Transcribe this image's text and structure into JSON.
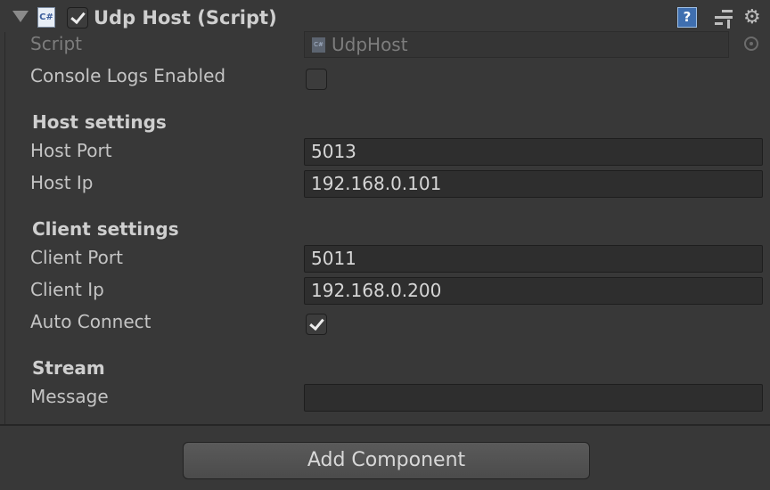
{
  "component": {
    "title": "Udp Host (Script)",
    "enabled": true,
    "icon_text": "C#"
  },
  "fields": {
    "script_label": "Script",
    "script_value": "UdpHost",
    "console_logs_label": "Console Logs Enabled",
    "console_logs_checked": false,
    "host_section": "Host settings",
    "host_port_label": "Host Port",
    "host_port_value": "5013",
    "host_ip_label": "Host Ip",
    "host_ip_value": "192.168.0.101",
    "client_section": "Client settings",
    "client_port_label": "Client Port",
    "client_port_value": "5011",
    "client_ip_label": "Client Ip",
    "client_ip_value": "192.168.0.200",
    "auto_connect_label": "Auto Connect",
    "auto_connect_checked": true,
    "stream_section": "Stream",
    "message_label": "Message",
    "message_value": ""
  },
  "footer": {
    "add_component_label": "Add Component"
  },
  "icons": {
    "foldout": "triangle-down-icon",
    "script": "csharp-script-icon",
    "help": "help-book-icon",
    "presets": "presets-icon",
    "settings": "gear-icon",
    "object_picker": "object-picker-icon"
  },
  "colors": {
    "panel_bg": "#383838",
    "field_bg": "#2e2e2e",
    "text": "#c4c4c4",
    "dim_text": "#7d7d7d",
    "help_blue": "#3f6fb0"
  }
}
